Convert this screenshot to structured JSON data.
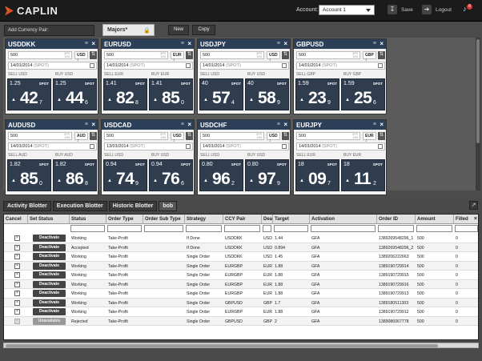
{
  "topbar": {
    "logo_text": "CAPLIN",
    "account_label": "Account:",
    "account_value": "Account 1",
    "save_label": "Save",
    "logout_label": "Logout",
    "notifications_count": "8"
  },
  "toolbar": {
    "add_currency_placeholder": "Add Currency Pair:",
    "workspace_tab": "Majors*",
    "new_label": "New",
    "copy_label": "Copy"
  },
  "tiles": [
    {
      "pair": "USDDKK",
      "amount": "500",
      "ofr": "OFR\n10M",
      "ccy": "USD",
      "date": "14/01/2014",
      "tenor": "(SPOT)",
      "sell_label": "SELL USD",
      "buy_label": "BUY USD",
      "sell_rate": "1.25",
      "sell_big": "42",
      "sell_small": "7",
      "buy_rate": "1.25",
      "buy_big": "44",
      "buy_small": "6",
      "spot": "SPOT"
    },
    {
      "pair": "EURUSD",
      "amount": "500",
      "ofr": "OFR\n10M",
      "ccy": "EUR",
      "date": "14/01/2014",
      "tenor": "(SPOT)",
      "sell_label": "SELL EUR",
      "buy_label": "BUY EUR",
      "sell_rate": "1.41",
      "sell_big": "82",
      "sell_small": "8",
      "buy_rate": "1.41",
      "buy_big": "85",
      "buy_small": "0",
      "spot": "SPOT"
    },
    {
      "pair": "USDJPY",
      "amount": "500",
      "ofr": "OFR\n10M",
      "ccy": "USD",
      "date": "14/01/2014",
      "tenor": "(SPOT)",
      "sell_label": "SELL USD",
      "buy_label": "BUY USD",
      "sell_rate": "40",
      "sell_big": "57",
      "sell_small": "4",
      "buy_rate": "40",
      "buy_big": "58",
      "buy_small": "9",
      "spot": "SPOT"
    },
    {
      "pair": "GBPUSD",
      "amount": "500",
      "ofr": "OFR\n10M",
      "ccy": "GBP",
      "date": "14/01/2014",
      "tenor": "(SPOT)",
      "sell_label": "SELL GBP",
      "buy_label": "BUY GBP",
      "sell_rate": "1.59",
      "sell_big": "23",
      "sell_small": "9",
      "buy_rate": "1.59",
      "buy_big": "25",
      "buy_small": "6",
      "spot": "SPOT"
    },
    {
      "pair": "AUDUSD",
      "amount": "500",
      "ofr": "OFR\n10M",
      "ccy": "AUD",
      "date": "14/01/2014",
      "tenor": "(SPOT)",
      "sell_label": "SELL AUD",
      "buy_label": "BUY AUD",
      "sell_rate": "1.82",
      "sell_big": "85",
      "sell_small": "0",
      "buy_rate": "1.82",
      "buy_big": "86",
      "buy_small": "8",
      "spot": "SPOT"
    },
    {
      "pair": "USDCAD",
      "amount": "500",
      "ofr": "OFR\n10M",
      "ccy": "USD",
      "date": "13/01/2014",
      "tenor": "(SPOT)",
      "sell_label": "SELL USD",
      "buy_label": "BUY USD",
      "sell_rate": "0.94",
      "sell_big": "74",
      "sell_small": "9",
      "buy_rate": "0.94",
      "buy_big": "76",
      "buy_small": "6",
      "spot": "SPOT"
    },
    {
      "pair": "USDCHF",
      "amount": "500",
      "ofr": "OFR\n10M",
      "ccy": "USD",
      "date": "14/01/2014",
      "tenor": "(SPOT)",
      "sell_label": "SELL USD",
      "buy_label": "BUY USD",
      "sell_rate": "0.80",
      "sell_big": "96",
      "sell_small": "2",
      "buy_rate": "0.80",
      "buy_big": "97",
      "buy_small": "9",
      "spot": "SPOT"
    },
    {
      "pair": "EURJPY",
      "amount": "500",
      "ofr": "OFR\n10M",
      "ccy": "EUR",
      "date": "14/01/2014",
      "tenor": "(SPOT)",
      "sell_label": "SELL EUR",
      "buy_label": "BUY EUR",
      "sell_rate": "18",
      "sell_big": "09",
      "sell_small": "7",
      "buy_rate": "18",
      "buy_big": "11",
      "buy_small": "2",
      "spot": "SPOT"
    }
  ],
  "blotter": {
    "tabs": [
      "Activity Blotter",
      "Execution Blotter",
      "Historic Blotter",
      "bob"
    ],
    "active_tab": 3,
    "columns": [
      "Cancel",
      "Set Status",
      "Status",
      "Order Type",
      "Order Sub Type",
      "Strategy",
      "CCY Pair",
      "Dea",
      "Target",
      "Activation",
      "Order ID",
      "Amount",
      "Filled"
    ],
    "rows": [
      {
        "btn": "Deactivate",
        "status": "Working",
        "otype": "Take-Profit",
        "osub": "",
        "strategy": "If Done",
        "pair": "USDDKK",
        "dealt": "USD",
        "target": "1.44",
        "activation": "GFA",
        "id": "1389269548296_1",
        "amount": "500",
        "filled": "0",
        "disabled": false
      },
      {
        "btn": "Deactivate",
        "status": "Accepted",
        "otype": "Take-Profit",
        "osub": "",
        "strategy": "If Done",
        "pair": "USDDKK",
        "dealt": "USD",
        "target": "0.894",
        "activation": "GFA",
        "id": "1389269548296_2",
        "amount": "500",
        "filled": "0",
        "disabled": false
      },
      {
        "btn": "Deactivate",
        "status": "Working",
        "otype": "Take-Profit",
        "osub": "",
        "strategy": "Single Order",
        "pair": "USDDKK",
        "dealt": "USD",
        "target": "1.45",
        "activation": "GFA",
        "id": "1389206222663",
        "amount": "500",
        "filled": "0",
        "disabled": false
      },
      {
        "btn": "Deactivate",
        "status": "Working",
        "otype": "Take-Profit",
        "osub": "",
        "strategy": "Single Order",
        "pair": "EURGBP",
        "dealt": "EUR",
        "target": "1.88",
        "activation": "GFA",
        "id": "1389190729914",
        "amount": "500",
        "filled": "0",
        "disabled": false
      },
      {
        "btn": "Deactivate",
        "status": "Working",
        "otype": "Take-Profit",
        "osub": "",
        "strategy": "Single Order",
        "pair": "EURGBP",
        "dealt": "EUR",
        "target": "1.88",
        "activation": "GFA",
        "id": "1389190729915",
        "amount": "500",
        "filled": "0",
        "disabled": false
      },
      {
        "btn": "Deactivate",
        "status": "Working",
        "otype": "Take-Profit",
        "osub": "",
        "strategy": "Single Order",
        "pair": "EURGBP",
        "dealt": "EUR",
        "target": "1.88",
        "activation": "GFA",
        "id": "1389190729916",
        "amount": "500",
        "filled": "0",
        "disabled": false
      },
      {
        "btn": "Deactivate",
        "status": "Working",
        "otype": "Take-Profit",
        "osub": "",
        "strategy": "Single Order",
        "pair": "EURGBP",
        "dealt": "EUR",
        "target": "1.88",
        "activation": "GFA",
        "id": "1389190729913",
        "amount": "500",
        "filled": "0",
        "disabled": false
      },
      {
        "btn": "Deactivate",
        "status": "Working",
        "otype": "Take-Profit",
        "osub": "",
        "strategy": "Single Order",
        "pair": "GBPUSD",
        "dealt": "GBP",
        "target": "1.7",
        "activation": "GFA",
        "id": "1389180511303",
        "amount": "500",
        "filled": "0",
        "disabled": false
      },
      {
        "btn": "Deactivate",
        "status": "Working",
        "otype": "Take-Profit",
        "osub": "",
        "strategy": "Single Order",
        "pair": "EURGBP",
        "dealt": "EUR",
        "target": "1.88",
        "activation": "GFA",
        "id": "1389190729912",
        "amount": "500",
        "filled": "0",
        "disabled": false
      },
      {
        "btn": "Unavailable",
        "status": "Rejected",
        "otype": "Take-Profit",
        "osub": "",
        "strategy": "Single Order",
        "pair": "GBPUSD",
        "dealt": "GBP",
        "target": "2",
        "activation": "GFA",
        "id": "1389086067778",
        "amount": "500",
        "filled": "0",
        "disabled": true
      }
    ]
  }
}
